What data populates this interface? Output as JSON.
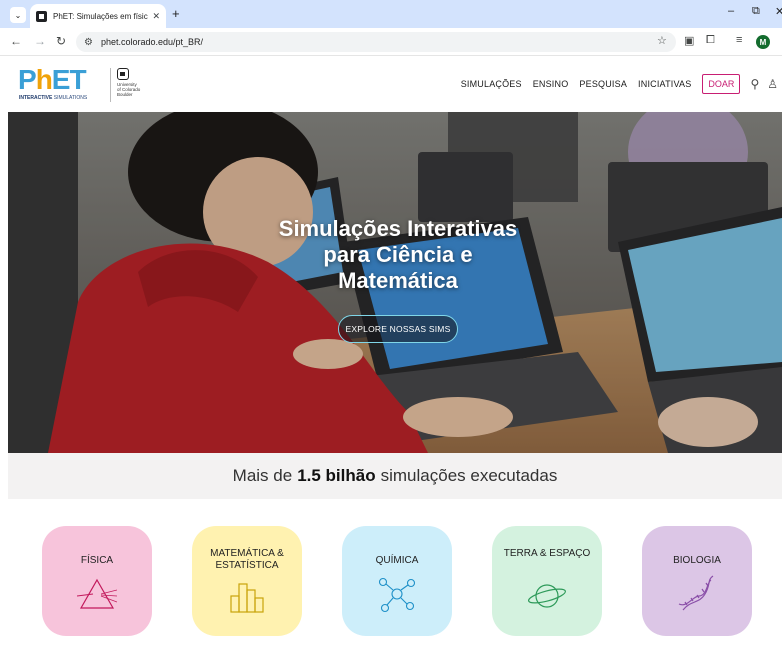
{
  "browser": {
    "tab_title": "PhET: Simulações em física, quí",
    "url": "phet.colorado.edu/pt_BR/",
    "profile_initial": "M"
  },
  "header": {
    "logo_text": "PhET",
    "logo_subtitle_bold": "INTERACTIVE",
    "logo_subtitle_rest": " SIMULATIONS",
    "partner_lines": [
      "University",
      "of Colorado",
      "Boulder"
    ],
    "nav": [
      "SIMULAÇÕES",
      "ENSINO",
      "PESQUISA",
      "INICIATIVAS"
    ],
    "donate_label": "DOAR"
  },
  "hero": {
    "title_lines": [
      "Simulações Interativas",
      "para Ciência e",
      "Matemática"
    ],
    "cta_label": "EXPLORE NOSSAS SIMS"
  },
  "stats": {
    "prefix": "Mais de",
    "highlight": "1.5 bilhão",
    "suffix": "simulações executadas"
  },
  "categories": [
    {
      "label": "FÍSICA",
      "color": "#f7c4db",
      "icon": "prism-icon"
    },
    {
      "label": "MATEMÁTICA & ESTATÍSTICA",
      "color": "#fff2b0",
      "icon": "bar-chart-icon"
    },
    {
      "label": "QUÍMICA",
      "color": "#cdeefa",
      "icon": "molecule-icon"
    },
    {
      "label": "TERRA & ESPAÇO",
      "color": "#d4f2df",
      "icon": "planet-icon"
    },
    {
      "label": "BIOLOGIA",
      "color": "#dcc6e6",
      "icon": "dna-icon"
    }
  ],
  "colors": {
    "browser_frame": "#d3e3fd",
    "donate_accent": "#c81e73",
    "cta_border": "#7fd6e8"
  }
}
